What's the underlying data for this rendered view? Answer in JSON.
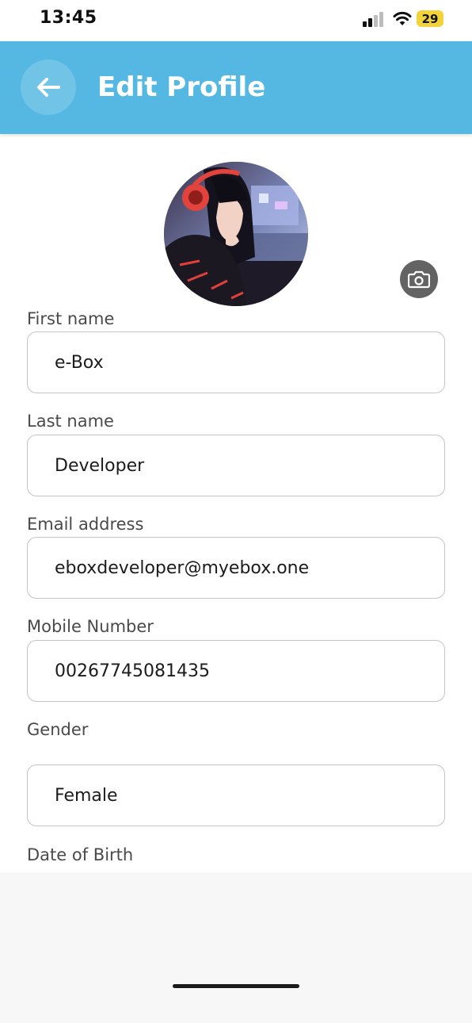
{
  "status_bar": {
    "time": "13:45",
    "battery": "29",
    "icons": [
      "signal-icon",
      "wifi-icon",
      "battery-icon"
    ]
  },
  "app_bar": {
    "title": "Edit Profile",
    "back_icon": "arrow-left-icon",
    "color": "#54b8e2"
  },
  "avatar": {
    "change_photo_icon": "camera-icon"
  },
  "form": {
    "first_name": {
      "label": "First name",
      "value": "e-Box"
    },
    "last_name": {
      "label": "Last name",
      "value": "Developer"
    },
    "email": {
      "label": "Email address",
      "value": "eboxdeveloper@myebox.one"
    },
    "mobile": {
      "label": "Mobile Number",
      "value": "00267745081435"
    },
    "gender": {
      "label": "Gender",
      "value": "Female"
    },
    "dob": {
      "label": "Date of Birth"
    }
  }
}
